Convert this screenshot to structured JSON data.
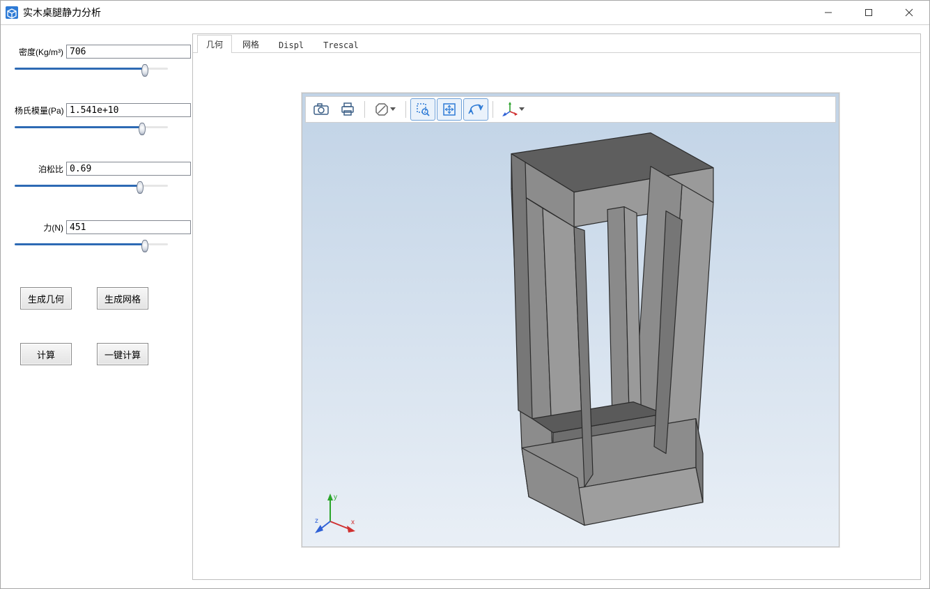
{
  "titlebar": {
    "title": "实木桌腿静力分析"
  },
  "sidebar": {
    "params": [
      {
        "label": "密度(Kg/m³)",
        "value": "706",
        "slider_pct": 85
      },
      {
        "label": "杨氏模量(Pa)",
        "value": "1.541e+10",
        "slider_pct": 83
      },
      {
        "label": "泊松比",
        "value": "0.69",
        "slider_pct": 82
      },
      {
        "label": "力(N)",
        "value": "451",
        "slider_pct": 85
      }
    ],
    "buttons": {
      "gen_geom": "生成几何",
      "gen_mesh": "生成网格",
      "compute": "计算",
      "compute_one": "一键计算"
    }
  },
  "tabs": [
    {
      "label": "几何",
      "active": true
    },
    {
      "label": "网格",
      "active": false
    },
    {
      "label": "Displ",
      "active": false
    },
    {
      "label": "Trescal",
      "active": false
    }
  ],
  "toolbar": {
    "items": [
      {
        "name": "camera-icon",
        "framed": false,
        "dropdown": false
      },
      {
        "name": "print-icon",
        "framed": false,
        "dropdown": false
      },
      {
        "sep": true
      },
      {
        "name": "no-entry-icon",
        "framed": false,
        "dropdown": true
      },
      {
        "sep": true
      },
      {
        "name": "zoom-rect-icon",
        "framed": true,
        "dropdown": false
      },
      {
        "name": "fit-view-icon",
        "framed": true,
        "dropdown": false
      },
      {
        "name": "rotate-icon",
        "framed": true,
        "dropdown": false
      },
      {
        "sep": true
      },
      {
        "name": "axes-icon",
        "framed": false,
        "dropdown": true
      }
    ]
  },
  "axis_labels": {
    "x": "x",
    "y": "y",
    "z": "z"
  }
}
